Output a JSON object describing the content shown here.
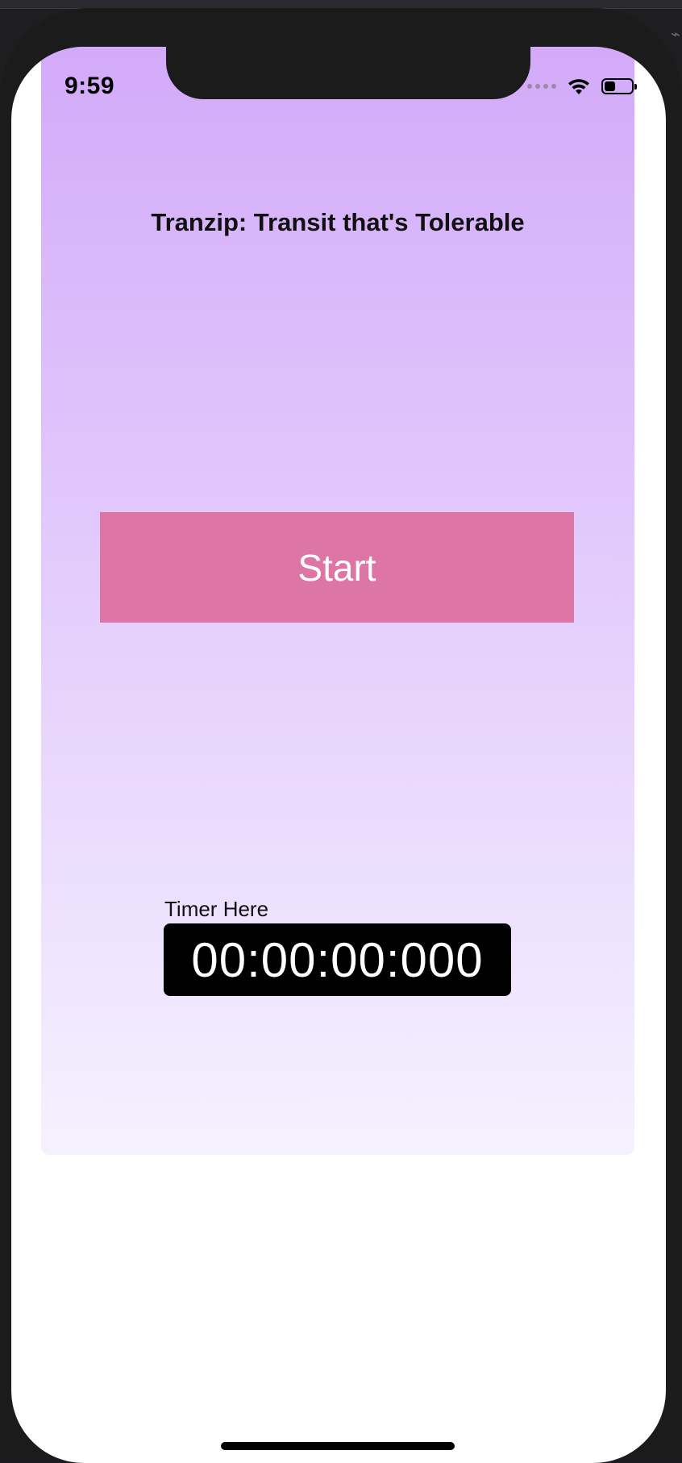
{
  "status_bar": {
    "time": "9:59",
    "battery_level": 0.4,
    "icons": [
      "signal-dots-icon",
      "wifi-icon",
      "battery-icon"
    ]
  },
  "app": {
    "title": "Tranzip: Transit that's Tolerable",
    "start_button_label": "Start",
    "timer_label": "Timer Here",
    "timer_value": "00:00:00:000"
  },
  "colors": {
    "gradient_top": "#d3aaf9",
    "gradient_bottom": "#f5f1ff",
    "start_button": "#dd76a5",
    "timer_background": "#000000",
    "timer_text": "#ffffff"
  }
}
